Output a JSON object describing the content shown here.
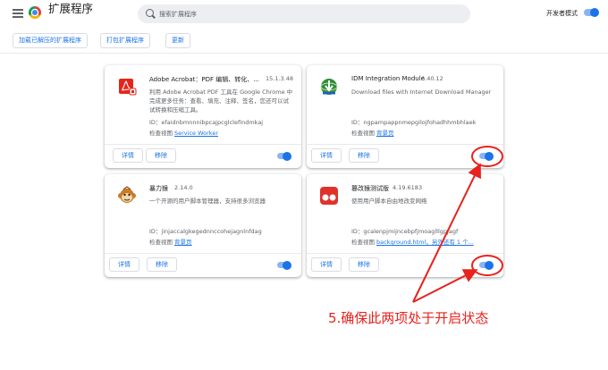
{
  "header": {
    "title": "扩展程序",
    "search_placeholder": "搜索扩展程序",
    "dev_mode_label": "开发者模式"
  },
  "toolbar": {
    "load_unpacked": "加载已解压的扩展程序",
    "pack": "打包扩展程序",
    "update": "更新"
  },
  "extensions": [
    {
      "name": "Adobe Acrobat：PDF 编辑、转化、...",
      "version": "15.1.3.48",
      "description": "利用 Adobe Acrobat PDF 工具在 Google Chrome 中完成更多任务：查看、填充、注释、签名，您还可以试试转换和压缩工具。",
      "id": "ID：efaidnbmnnnibpcajpcglclefindmkaj",
      "inspect_label": "检查视图",
      "inspect_link": "Service Worker",
      "details_label": "详情",
      "remove_label": "移除",
      "enabled": true,
      "icon": "adobe-acrobat-icon"
    },
    {
      "name": "IDM Integration Module",
      "version": "6.40.12",
      "description": "Download files with Internet Download Manager",
      "id": "ID：ngpampappnmepgilojfohadhhmbhlaek",
      "inspect_label": "检查视图",
      "inspect_link": "背景页",
      "details_label": "详情",
      "remove_label": "移除",
      "enabled": true,
      "icon": "idm-icon"
    },
    {
      "name": "暴力猴",
      "version": "2.14.0",
      "description": "一个开源的用户脚本管理器，支持很多浏览器",
      "id": "ID：jinjaccalgkegednnccohejagnlnfdag",
      "inspect_label": "检查视图",
      "inspect_link": "背景页",
      "details_label": "详情",
      "remove_label": "移除",
      "enabled": true,
      "icon": "violentmonkey-icon"
    },
    {
      "name": "篡改猴测试版",
      "version": "4.19.6183",
      "description": "使用用户脚本自由地改变网络",
      "id": "ID：gcalenpjmijncebpfjmoaglllgpjagf",
      "inspect_label": "检查视图",
      "inspect_link": "background.html，另外还有 1 个...",
      "details_label": "详情",
      "remove_label": "移除",
      "enabled": true,
      "icon": "tampermonkey-icon"
    }
  ],
  "annotation": {
    "text": "5.确保此两项处于开启状态",
    "color": "#e8221c"
  }
}
